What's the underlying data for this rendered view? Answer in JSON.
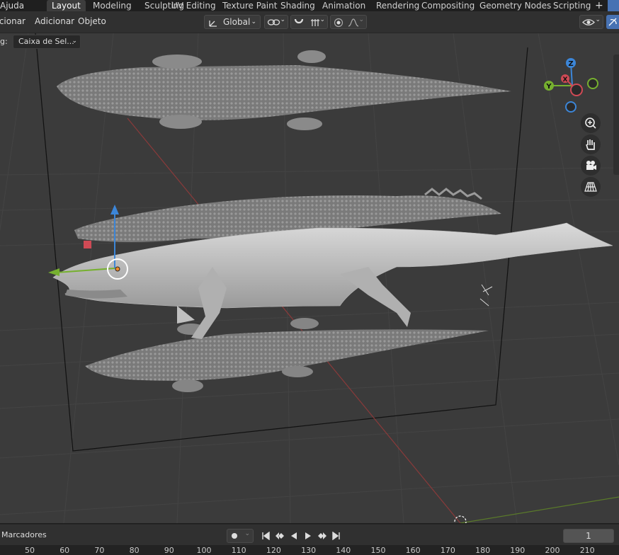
{
  "menubar": {
    "help": "Ajuda",
    "tabs": [
      "Layout",
      "Modeling",
      "Sculpting",
      "UV Editing",
      "Texture Paint",
      "Shading",
      "Animation",
      "Rendering",
      "Compositing",
      "Geometry Nodes",
      "Scripting"
    ],
    "add_tab": "+"
  },
  "header": {
    "select": "Selecionar",
    "add": "Adicionar",
    "object": "Objeto",
    "orientation": "Global"
  },
  "viewport": {
    "select_label": "g:",
    "select_mode": "Caixa de Sel..."
  },
  "gizmo": {
    "z": "Z",
    "y": "Y",
    "x": "X"
  },
  "timeline": {
    "markers": "Marcadores",
    "frame": "1",
    "ruler": [
      "50",
      "60",
      "70",
      "80",
      "90",
      "100",
      "110",
      "120",
      "130",
      "140",
      "150",
      "160",
      "170",
      "180",
      "190",
      "200",
      "210"
    ]
  },
  "colors": {
    "x_axis": "#d04a55",
    "y_axis": "#76b02f",
    "z_axis": "#3c86d8",
    "active_tab": "#3d3d3d",
    "accent": "#4772b3"
  }
}
